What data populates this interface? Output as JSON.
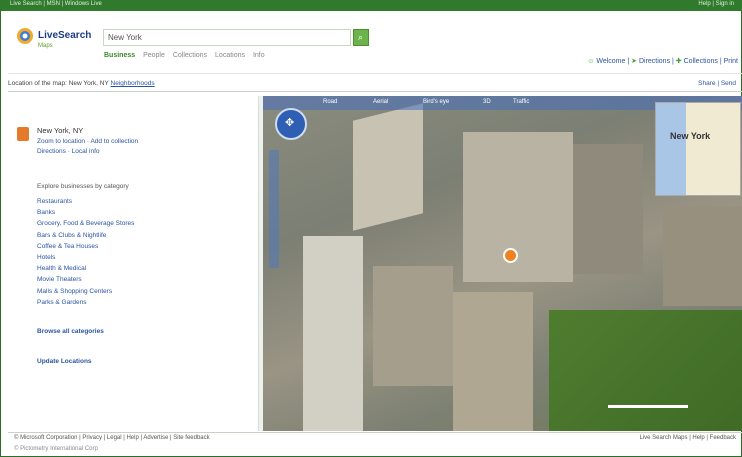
{
  "app": {
    "brand": "LiveSearch",
    "brand_sub": "Maps"
  },
  "topbar": {
    "links": "Live Search | MSN | Windows Live",
    "right": "Help | Sign in"
  },
  "search": {
    "value": "New York",
    "button_icon": "search-icon"
  },
  "nav": {
    "items": [
      "Business",
      "People",
      "Collections",
      "Locations",
      "Info"
    ],
    "active_index": 0
  },
  "header_right": {
    "items": [
      "Welcome",
      "Directions",
      "Collections",
      "Print"
    ]
  },
  "subbar": {
    "text": "Location of the map: New York, NY",
    "link": "Neighborhoods",
    "right": "Share | Send"
  },
  "location": {
    "title": "New York, NY",
    "links": "Zoom to location · Add to collection",
    "links2": "Directions · Local info"
  },
  "categories": {
    "heading": "Explore businesses by category",
    "items": [
      "Restaurants",
      "Banks",
      "Grocery, Food & Beverage Stores",
      "Bars & Clubs & Nightlife",
      "Coffee & Tea Houses",
      "Hotels",
      "Health & Medical",
      "Movie Theaters",
      "Malls & Shopping Centers",
      "Parks & Gardens"
    ],
    "more": "Browse all categories",
    "update": "Update Locations"
  },
  "map": {
    "tools": [
      "Road",
      "Aerial",
      "Bird's eye",
      "3D",
      "Traffic"
    ],
    "minimap_label": "New York",
    "compass_icon": "compass-icon"
  },
  "footer": {
    "left": "© Microsoft Corporation | Privacy | Legal | Help | Advertise | Site feedback",
    "left2": "© Pictometry International Corp",
    "right": "Live Search Maps | Help | Feedback"
  },
  "colors": {
    "brand_green": "#2f7a2c",
    "link_blue": "#2a55a0",
    "map_accent": "#2f5fb3"
  }
}
